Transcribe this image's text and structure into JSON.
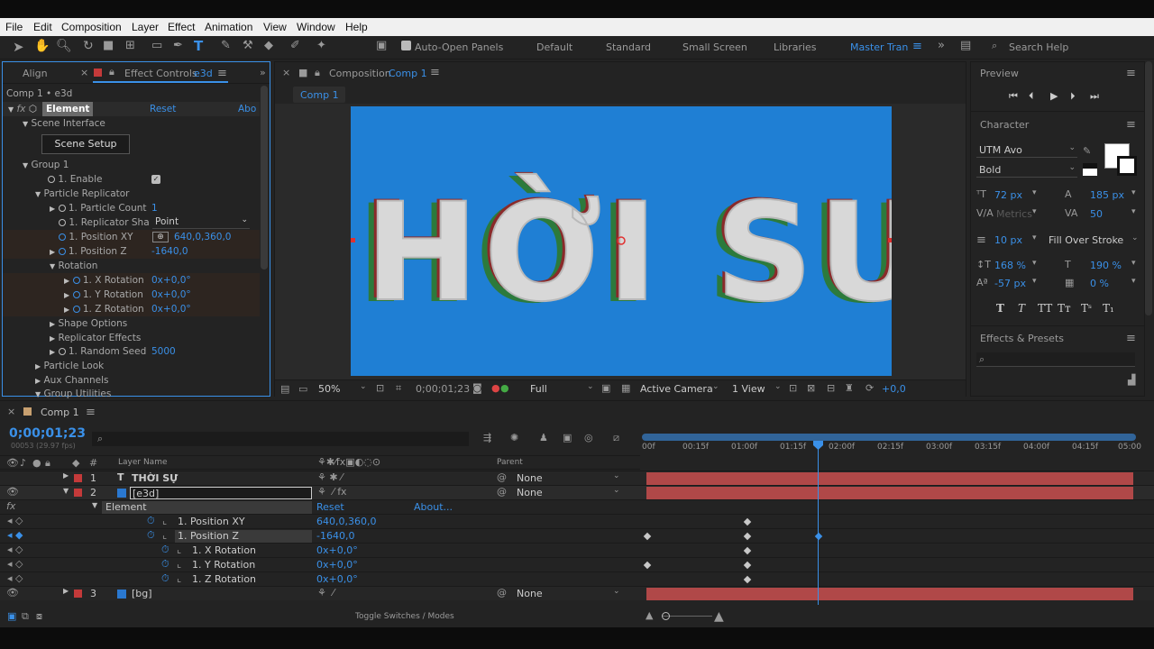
{
  "menu": [
    "File",
    "Edit",
    "Composition",
    "Layer",
    "Effect",
    "Animation",
    "View",
    "Window",
    "Help"
  ],
  "toolbar": {
    "auto_open": "Auto-Open Panels",
    "workspaces": [
      "Default",
      "Standard",
      "Small Screen",
      "Libraries"
    ],
    "active_workspace": "Master Tran",
    "search": "Search Help"
  },
  "left": {
    "tab_align": "Align",
    "tab_effect_controls": "Effect Controls",
    "tab_effect_layer": "e3d",
    "breadcrumb": "Comp 1 • e3d",
    "effect_name": "Element",
    "reset": "Reset",
    "about": "Abo",
    "scene_interface": "Scene Interface",
    "scene_setup": "Scene Setup",
    "group1": "Group 1",
    "enable": "1. Enable",
    "particle_replicator": "Particle Replicator",
    "particle_count": "1. Particle Count",
    "particle_count_val": "1",
    "replicator_shape": "1. Replicator Sha",
    "replicator_shape_val": "Point",
    "position_xy": "1. Position XY",
    "position_xy_val": "640,0,360,0",
    "position_z": "1. Position Z",
    "position_z_val": "-1640,0",
    "rotation": "Rotation",
    "x_rot": "1. X Rotation",
    "y_rot": "1. Y Rotation",
    "z_rot": "1. Z Rotation",
    "rot_val": "0x+0,0°",
    "shape_options": "Shape Options",
    "replicator_effects": "Replicator Effects",
    "random_seed": "1. Random Seed",
    "random_seed_val": "5000",
    "particle_look": "Particle Look",
    "aux_channels": "Aux Channels",
    "group_utilities": "Group Utilities"
  },
  "comp": {
    "tab_label": "Composition",
    "tab_name": "Comp 1",
    "subtab": "Comp 1",
    "title_text": "HỜI SƯ",
    "zoom": "50%",
    "timecode": "0;00;01;23",
    "resolution": "Full",
    "camera": "Active Camera",
    "views": "1 View",
    "exposure": "+0,0"
  },
  "right": {
    "preview": "Preview",
    "character": "Character",
    "font": "UTM Avo",
    "style": "Bold",
    "size": "72 px",
    "leading": "185 px",
    "kerning": "Metrics",
    "tracking": "50",
    "stroke": "10 px",
    "stroke_type": "Fill Over Stroke",
    "vscale": "168 %",
    "hscale": "190 %",
    "baseline": "-57 px",
    "tsume": "0 %",
    "effects_presets": "Effects & Presets"
  },
  "timeline": {
    "tab": "Comp 1",
    "timecode": "0;00;01;23",
    "frames": "00053 (29.97 fps)",
    "col_layer": "Layer Name",
    "col_parent": "Parent",
    "ruler": [
      "00f",
      "00:15f",
      "01:00f",
      "01:15f",
      "02:00f",
      "02:15f",
      "03:00f",
      "03:15f",
      "04:00f",
      "04:15f",
      "05:00"
    ],
    "layers": [
      {
        "num": "1",
        "name": "THỜI SỰ",
        "parent": "None"
      },
      {
        "num": "2",
        "name": "[e3d]",
        "parent": "None"
      },
      {
        "num": "3",
        "name": "[bg]",
        "parent": "None"
      }
    ],
    "effect": "Element",
    "reset": "Reset",
    "about": "About...",
    "props": [
      {
        "name": "1. Position XY",
        "val": "640,0,360,0"
      },
      {
        "name": "1. Position Z",
        "val": "-1640,0"
      },
      {
        "name": "1. X Rotation",
        "val": "0x+0,0°"
      },
      {
        "name": "1. Y Rotation",
        "val": "0x+0,0°"
      },
      {
        "name": "1. Z Rotation",
        "val": "0x+0,0°"
      }
    ],
    "toggle": "Toggle Switches / Modes"
  },
  "colors": {
    "accent": "#3a90e8",
    "comp_bg": "#1f7fd4",
    "layer_bar": "#b04848",
    "label_red": "#c43a3a"
  }
}
